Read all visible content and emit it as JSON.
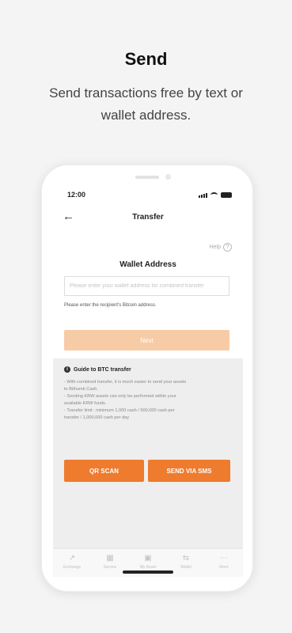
{
  "promo": {
    "title": "Send",
    "subtitle": "Send transactions free by text or wallet address."
  },
  "status_bar": {
    "time": "12:00"
  },
  "header": {
    "back_icon": "arrow-left-icon",
    "title": "Transfer"
  },
  "help": {
    "label": "Help",
    "icon": "question-circle-icon"
  },
  "wallet": {
    "label": "Wallet Address",
    "placeholder": "Please enter your wallet address for combined transfer",
    "value": "",
    "hint": "Please enter the recipient's Bitcoin address."
  },
  "next_button": {
    "label": "Next"
  },
  "guide": {
    "icon": "info-icon",
    "title": "Guide to BTC transfer",
    "items": [
      "- With combined transfer, it is much easier to send your assets",
      "  to Bithumb Cash.",
      "- Sending KRW assets can only be performed within your",
      "  available KRW funds.",
      "- Transfer limit : minimum 1,000 cash / 500,000 cash per",
      "  transfer / 1,000,000 cash per day"
    ]
  },
  "actions": {
    "qr_scan": "QR SCAN",
    "send_sms": "SEND VIA SMS"
  },
  "tabs": [
    {
      "label": "Exchange",
      "icon": "chart-icon"
    },
    {
      "label": "Service",
      "icon": "grid-icon"
    },
    {
      "label": "My Asset",
      "icon": "wallet-icon"
    },
    {
      "label": "Wallet",
      "icon": "transfer-icon"
    },
    {
      "label": "More",
      "icon": "more-icon"
    }
  ],
  "colors": {
    "accent": "#ee7b2e",
    "next_disabled": "#f7cba6",
    "guide_bg": "#eeeeee",
    "page_bg": "#f4f4f4"
  }
}
